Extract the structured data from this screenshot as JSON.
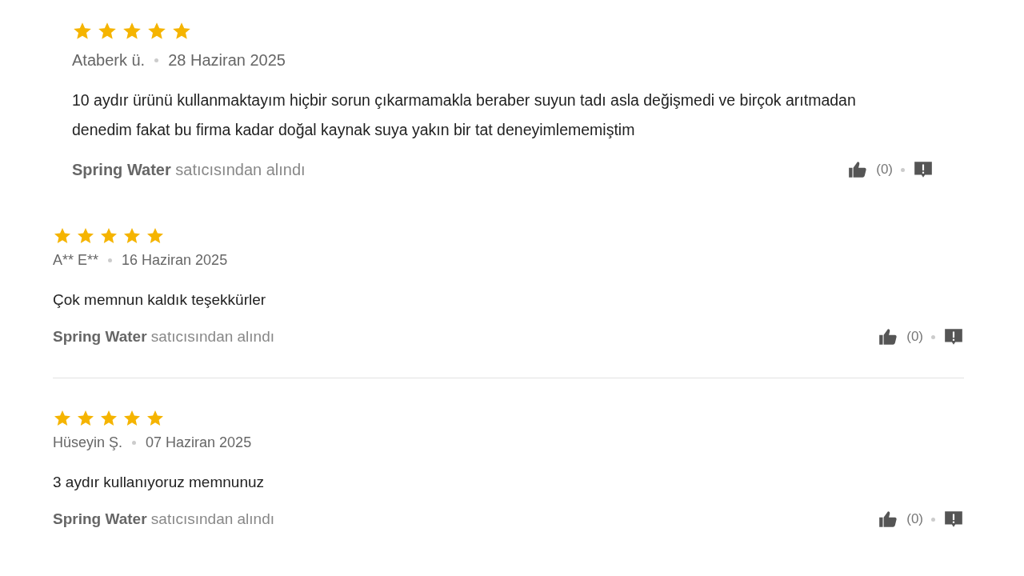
{
  "reviews": [
    {
      "stars": 5,
      "author": "Ataberk ü.",
      "date": "28 Haziran 2025",
      "text": "10 aydır ürünü kullanmaktayım hiçbir sorun çıkarmamakla beraber suyun tadı asla değişmedi ve birçok arıtmadan denedim fakat bu firma kadar doğal kaynak suya yakın bir tat deneyimlememiştim",
      "seller": "Spring Water",
      "seller_suffix": "satıcısından alındı",
      "likes": "(0)"
    },
    {
      "stars": 5,
      "author": "A** E**",
      "date": "16 Haziran 2025",
      "text": "Çok memnun kaldık teşekkürler",
      "seller": "Spring Water",
      "seller_suffix": "satıcısından alındı",
      "likes": "(0)"
    },
    {
      "stars": 5,
      "author": "Hüseyin Ş.",
      "date": "07 Haziran 2025",
      "text": "3 aydır kullanıyoruz memnunuz",
      "seller": "Spring Water",
      "seller_suffix": "satıcısından alındı",
      "likes": "(0)"
    }
  ]
}
